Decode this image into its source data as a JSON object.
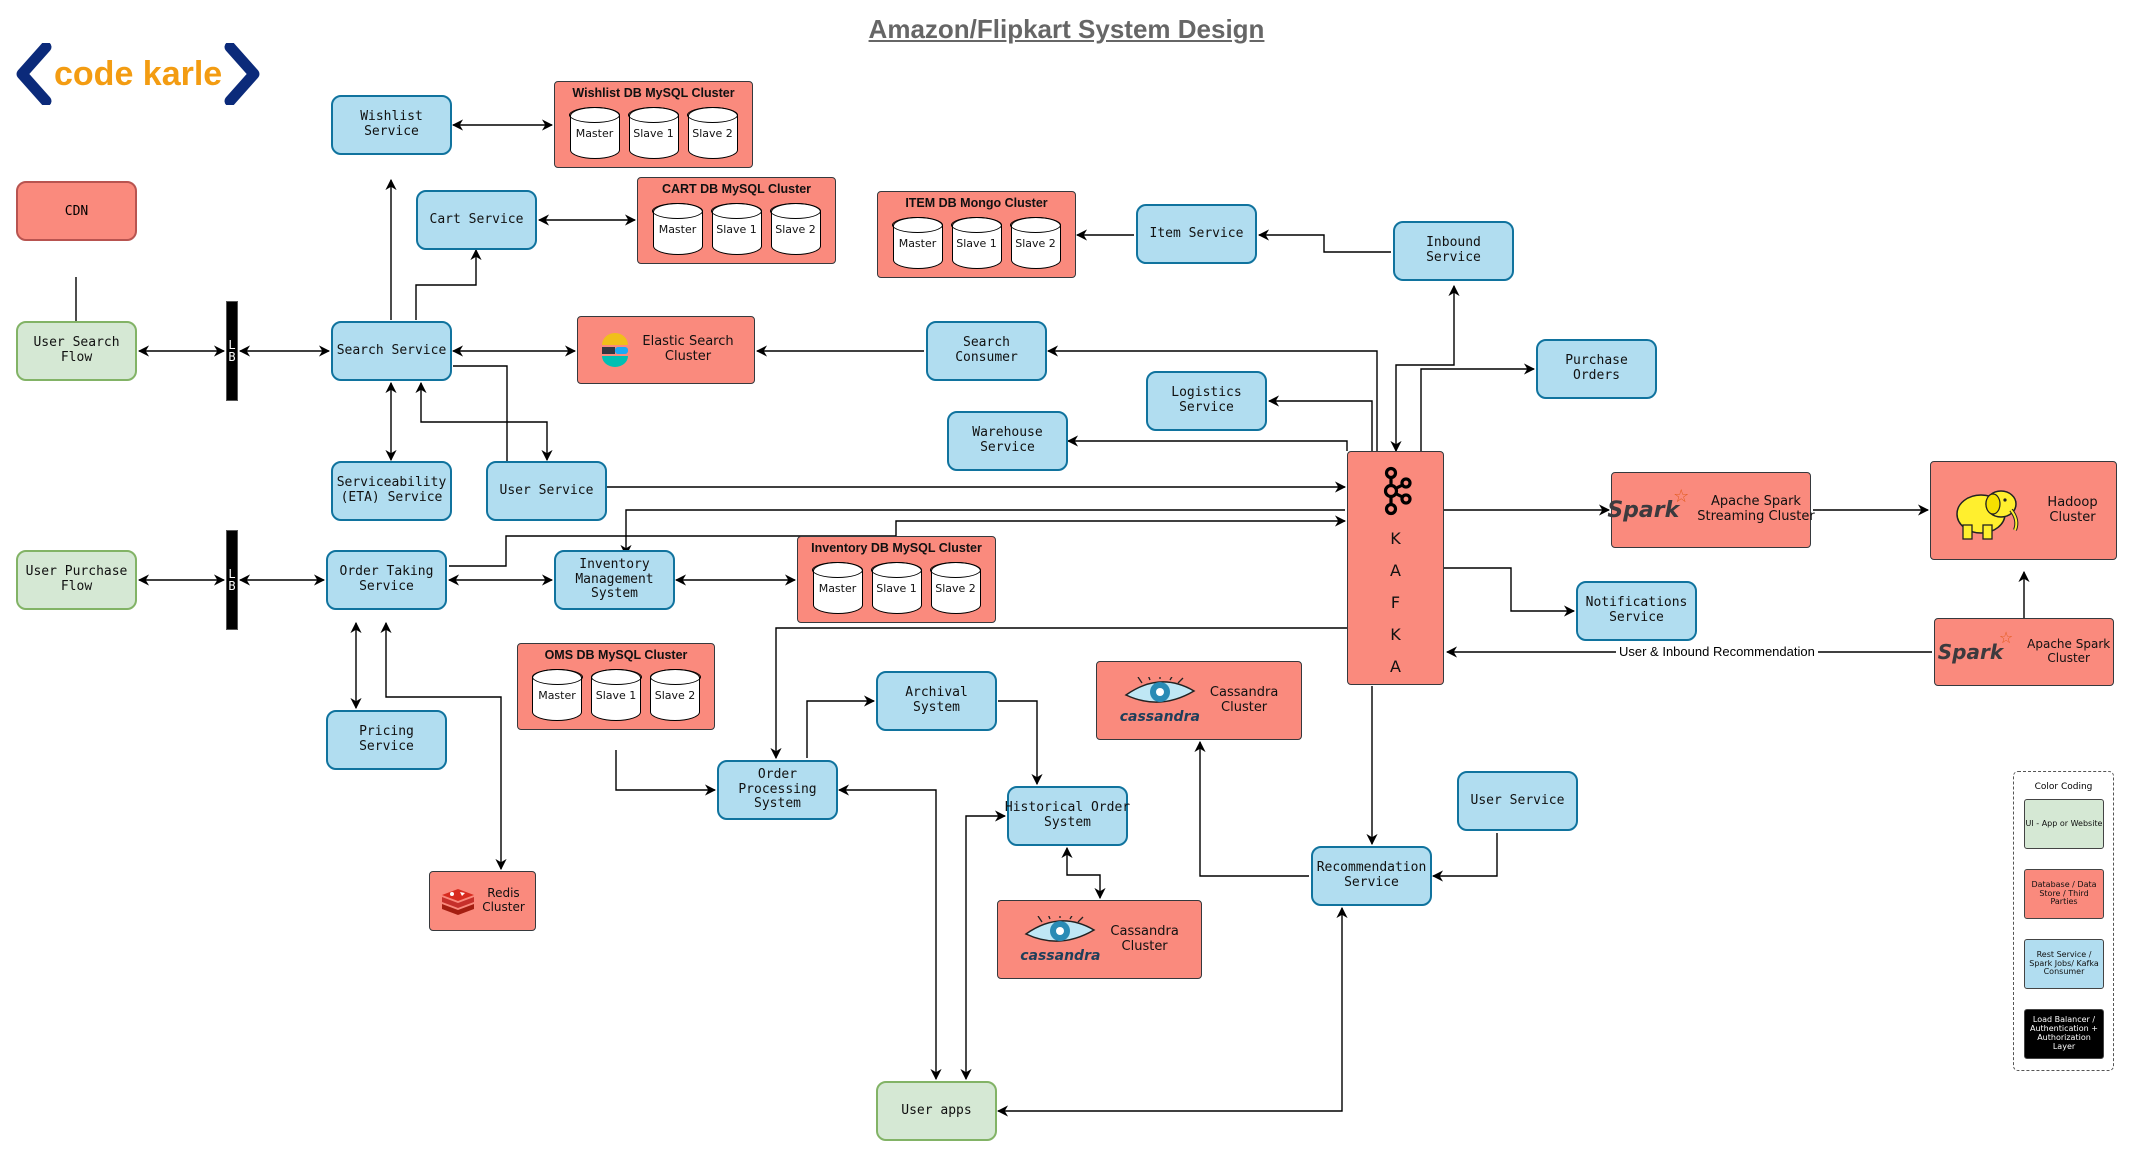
{
  "title": "Amazon/Flipkart System Design",
  "brand": {
    "text": "code karle",
    "bracket_color": "#0b2a7a",
    "text_color": "#f39c12"
  },
  "colors": {
    "ui": "#d5e8d4",
    "database": "#fa8a7d",
    "service": "#b1ddf0",
    "load_balancer": "#000000"
  },
  "nodes": {
    "cdn": "CDN",
    "user_search_flow": "User Search\nFlow",
    "user_purchase_flow": "User Purchase\nFlow",
    "lb1": [
      "L",
      "B"
    ],
    "lb2": [
      "L",
      "B"
    ],
    "wishlist_service": "Wishlist\nService",
    "cart_service": "Cart Service",
    "search_service": "Search Service",
    "serviceability_service": "Serviceability\n(ETA) Service",
    "user_service_search": "User Service",
    "order_taking_service": "Order Taking\nService",
    "inventory_management": "Inventory\nManagement\nSystem",
    "pricing_service": "Pricing Service",
    "redis_cluster": "Redis\nCluster",
    "order_processing": "Order\nProcessing\nSystem",
    "archival_system": "Archival System",
    "historical_order": "Historical Order\nSystem",
    "user_apps": "User apps",
    "elastic_search": "Elastic Search\nCluster",
    "search_consumer": "Search Consumer",
    "logistics_service": "Logistics\nService",
    "warehouse_service": "Warehouse\nService",
    "item_service": "Item Service",
    "inbound_service": "Inbound Service",
    "purchase_orders": "Purchase Orders",
    "kafka_letters": [
      "K",
      "A",
      "F",
      "K",
      "A"
    ],
    "spark_streaming": "Apache Spark\nStreaming Cluster",
    "hadoop": "Hadoop\nCluster",
    "notifications": "Notifications\nService",
    "spark_cluster": "Apache Spark\nCluster",
    "cassandra_1": "Cassandra\nCluster",
    "cassandra_2": "Cassandra\nCluster",
    "recommendation": "Recommendation\nService",
    "user_service_reco": "User Service"
  },
  "clusters": {
    "wishlist_db": {
      "title": "Wishlist DB MySQL Cluster",
      "nodes": [
        "Master",
        "Slave 1",
        "Slave 2"
      ]
    },
    "cart_db": {
      "title": "CART DB MySQL Cluster",
      "nodes": [
        "Master",
        "Slave 1",
        "Slave 2"
      ]
    },
    "item_db": {
      "title": "ITEM DB Mongo Cluster",
      "nodes": [
        "Master",
        "Slave 1",
        "Slave 2"
      ]
    },
    "inventory_db": {
      "title": "Inventory DB MySQL Cluster",
      "nodes": [
        "Master",
        "Slave 1",
        "Slave 2"
      ]
    },
    "oms_db": {
      "title": "OMS DB MySQL Cluster",
      "nodes": [
        "Master",
        "Slave 1",
        "Slave 2"
      ]
    }
  },
  "logos": {
    "spark": "Spark",
    "cassandra": "cassandra"
  },
  "edge_labels": {
    "recommendation": "User & Inbound Recommendation"
  },
  "legend": {
    "title": "Color Coding",
    "items": [
      {
        "label": "UI - App or Website",
        "color": "#d5e8d4"
      },
      {
        "label": "Database / Data Store / Third Parties",
        "color": "#fa8a7d"
      },
      {
        "label": "Rest Service / Spark Jobs/ Kafka Consumer",
        "color": "#b1ddf0"
      },
      {
        "label": "Load Balancer / Authentication + Authorization Layer",
        "color": "#000000"
      }
    ]
  }
}
